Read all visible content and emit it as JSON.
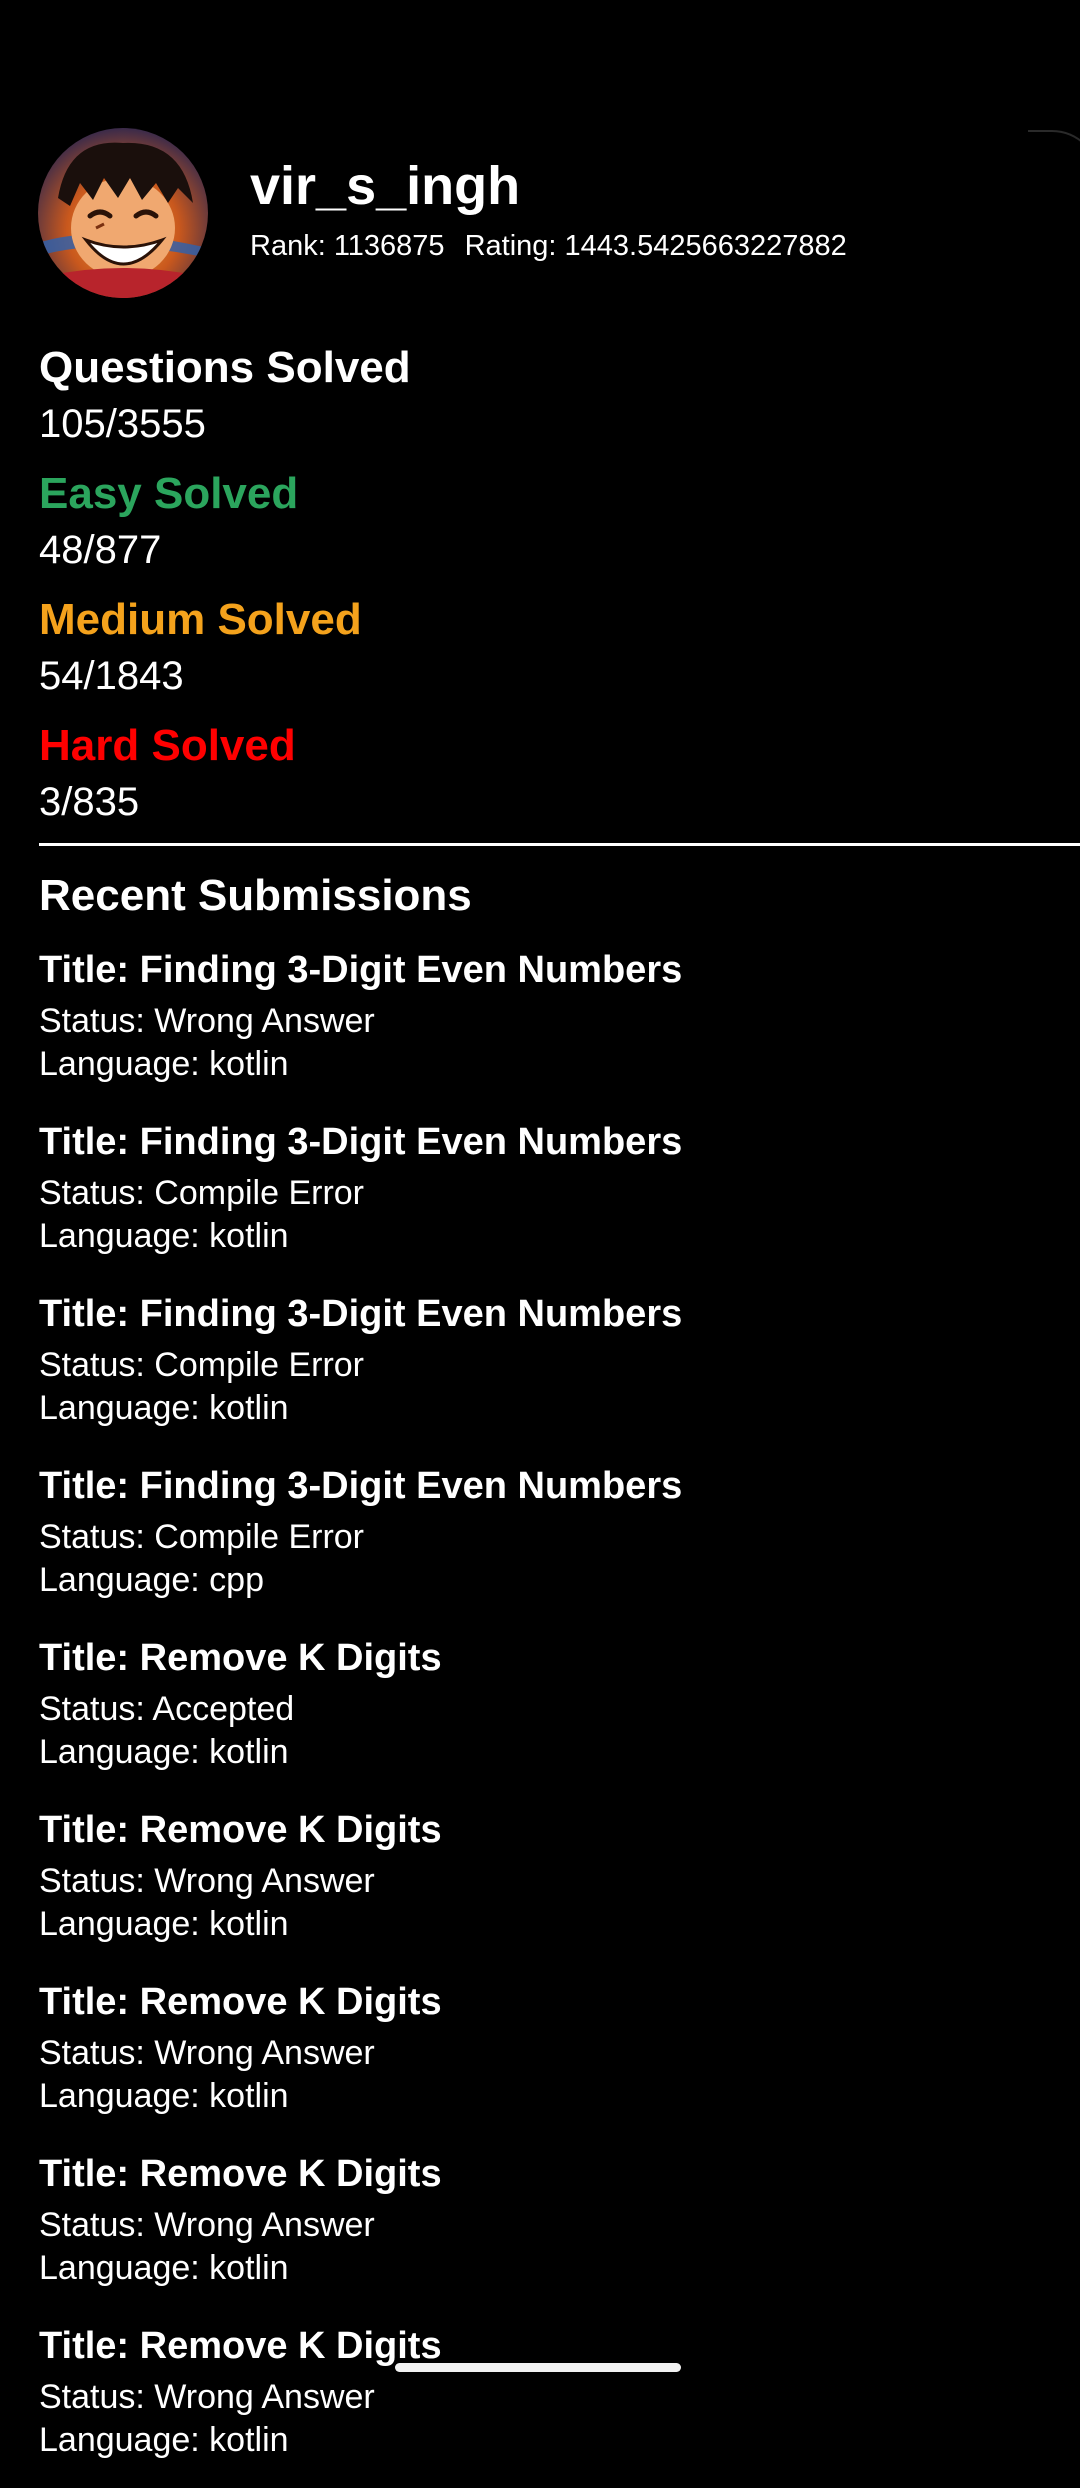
{
  "profile": {
    "username": "vir_s_ingh",
    "rank": "Rank: 1136875",
    "rating": "Rating: 1443.5425663227882",
    "avatar_icon": "anime-avatar-icon"
  },
  "stats": [
    {
      "label": "Questions Solved",
      "value": "105/3555",
      "color": "#ffffff"
    },
    {
      "label": "Easy Solved",
      "value": "48/877",
      "color": "#2ba55d"
    },
    {
      "label": "Medium Solved",
      "value": "54/1843",
      "color": "#f4a21c"
    },
    {
      "label": "Hard Solved",
      "value": "3/835",
      "color": "#ff0000"
    }
  ],
  "recent": {
    "heading": "Recent Submissions",
    "items": [
      {
        "title": "Title: Finding 3-Digit Even Numbers",
        "status": "Status: Wrong Answer",
        "language": "Language: kotlin"
      },
      {
        "title": "Title: Finding 3-Digit Even Numbers",
        "status": "Status: Compile Error",
        "language": "Language: kotlin"
      },
      {
        "title": "Title: Finding 3-Digit Even Numbers",
        "status": "Status: Compile Error",
        "language": "Language: kotlin"
      },
      {
        "title": "Title: Finding 3-Digit Even Numbers",
        "status": "Status: Compile Error",
        "language": "Language: cpp"
      },
      {
        "title": "Title: Remove K Digits",
        "status": "Status: Accepted",
        "language": "Language: kotlin"
      },
      {
        "title": "Title: Remove K Digits",
        "status": "Status: Wrong Answer",
        "language": "Language: kotlin"
      },
      {
        "title": "Title: Remove K Digits",
        "status": "Status: Wrong Answer",
        "language": "Language: kotlin"
      },
      {
        "title": "Title: Remove K Digits",
        "status": "Status: Wrong Answer",
        "language": "Language: kotlin"
      },
      {
        "title": "Title: Remove K Digits",
        "status": "Status: Wrong Answer",
        "language": "Language: kotlin"
      }
    ]
  }
}
